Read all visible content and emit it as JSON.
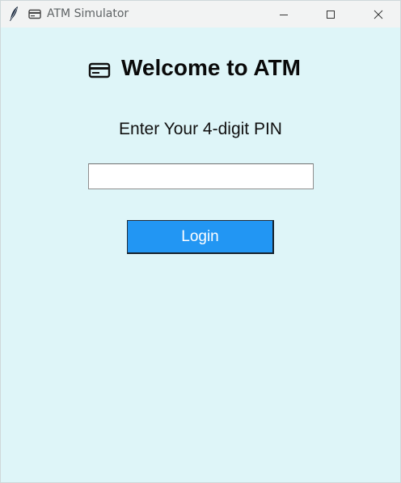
{
  "window": {
    "title": "ATM Simulator",
    "background": "#def5f8",
    "titlebar_icons": [
      "feather-icon",
      "credit-card-icon"
    ],
    "controls": [
      "minimize-icon",
      "maximize-icon",
      "close-icon"
    ]
  },
  "main": {
    "heading_icon": "credit-card-icon",
    "heading": "Welcome to ATM",
    "prompt": "Enter Your 4-digit PIN",
    "pin_input": {
      "value": "",
      "placeholder": ""
    },
    "login_label": "Login",
    "accent": "#2296f3"
  }
}
